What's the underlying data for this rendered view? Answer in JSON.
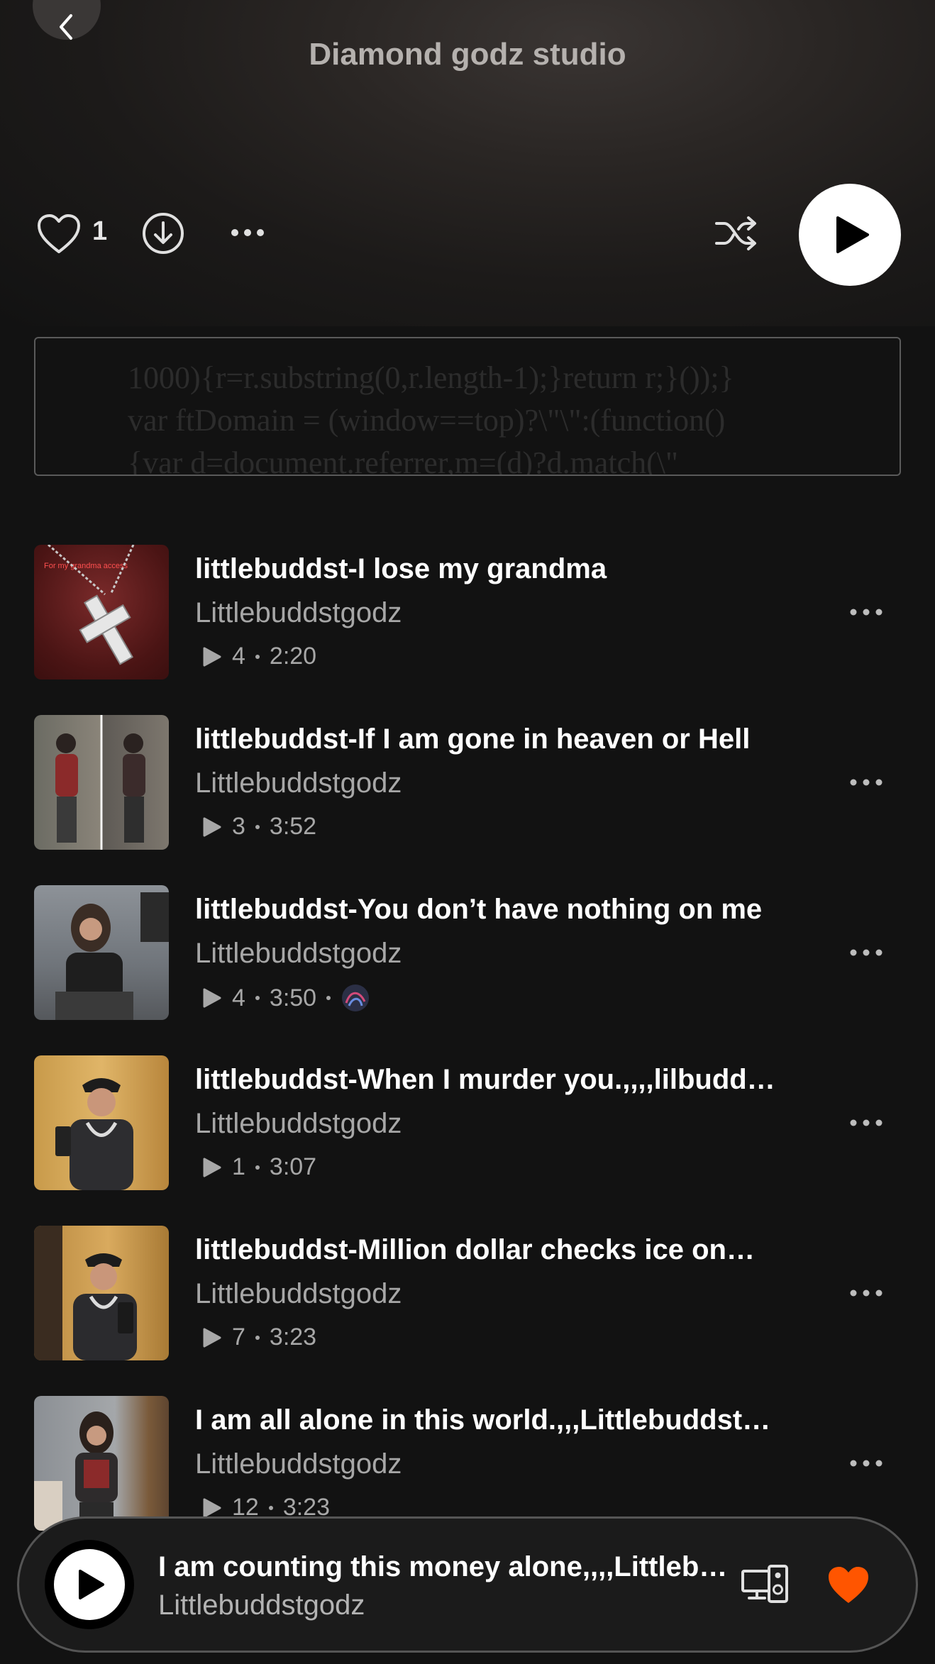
{
  "header": {
    "title": "Diamond godz studio"
  },
  "actions": {
    "like_count": "1",
    "colors": {
      "play_bg": "#ffffff",
      "heart": "#ff5500"
    }
  },
  "code_snippet": {
    "lines": [
      "1000){r=r.substring(0,r.length-1);}return r;}());}",
      "var ftDomain = (window==top)?\\\"\\\":(function()",
      "{var d=document.referrer,m=(d)?d.match(\\\""
    ]
  },
  "tracks": [
    {
      "title": "littlebuddst-I lose my grandma",
      "artist": "Littlebuddstgodz",
      "plays": "4",
      "duration": "2:20",
      "thumb_caption": "For my grandma access"
    },
    {
      "title": "littlebuddst-If I am gone in heaven or Hell",
      "artist": "Littlebuddstgodz",
      "plays": "3",
      "duration": "3:52"
    },
    {
      "title": "littlebuddst-You don’t have nothing on me",
      "artist": "Littlebuddstgodz",
      "plays": "4",
      "duration": "3:50"
    },
    {
      "title": "littlebuddst-When I murder you.,,,,lilbudd…",
      "artist": "Littlebuddstgodz",
      "plays": "1",
      "duration": "3:07"
    },
    {
      "title": "littlebuddst-Million dollar checks ice on…",
      "artist": "Littlebuddstgodz",
      "plays": "7",
      "duration": "3:23"
    },
    {
      "title": "I am all alone in this world.,,,Littlebuddst…",
      "artist": "Littlebuddstgodz",
      "plays": "12",
      "duration": "3:23"
    }
  ],
  "mini_player": {
    "title": "I am counting this money alone,,,,Littleb…",
    "artist": "Littlebuddstgodz"
  }
}
